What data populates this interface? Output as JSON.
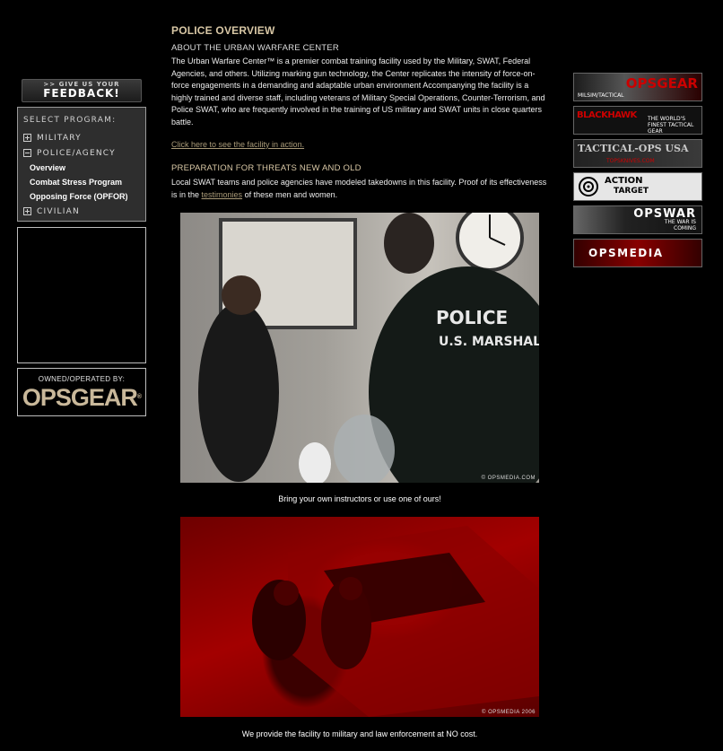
{
  "sidebar": {
    "feedback": {
      "top": ">> GIVE US YOUR",
      "main": "FEEDBACK!"
    },
    "program_header": "SELECT PROGRAM:",
    "programs": [
      {
        "label": "MILITARY",
        "toggle": "plus"
      },
      {
        "label": "POLICE/AGENCY",
        "toggle": "minus"
      }
    ],
    "police_sub": [
      "Overview",
      "Combat Stress Program",
      "Opposing Force (OPFOR)"
    ],
    "civilian": "CIVILIAN",
    "owned_label": "OWNED/OPERATED BY:",
    "owned_logo": "OPSGEAR",
    "owned_reg": "®"
  },
  "main": {
    "title": "POLICE OVERVIEW",
    "about_heading": "ABOUT THE URBAN WARFARE CENTER",
    "about_text": "The Urban Warfare Center™ is a premier combat training facility used by the Military, SWAT, Federal Agencies, and others. Utilizing marking gun technology, the Center replicates the intensity of force-on-force engagements in a demanding and adaptable urban environment Accompanying the facility is a highly trained and diverse staff, including veterans of Military Special Operations, Counter-Terrorism, and Police SWAT, who are frequently involved in the training of US military and SWAT units in close quarters battle.",
    "facility_link": "Click here to see the facility in action.",
    "prep_heading": "PREPARATION FOR THREATS NEW AND OLD",
    "prep_text_1": "Local SWAT teams and police agencies have modeled takedowns in this facility. Proof of its effectiveness is in the ",
    "prep_link": "testimonies",
    "prep_text_2": " of these men and women.",
    "photo1_watermark": "© OPSMEDIA.COM",
    "caption1": "Bring your own instructors or use one of ours!",
    "photo2_watermark": "© OPSMEDIA 2006",
    "caption2": "We provide the facility to military and law enforcement at NO cost."
  },
  "ads": [
    {
      "title": "OPSGEAR",
      "sub": "MILSIM/TACTICAL"
    },
    {
      "title": "BLACKHAWK",
      "sub": "THE WORLD'S FINEST TACTICAL GEAR"
    },
    {
      "title": "TACTICAL-OPS USA",
      "sub": "TOPSKNIVES.COM"
    },
    {
      "title": "ACTION",
      "sub": "TARGET"
    },
    {
      "title": "OPSWAR",
      "sub": "THE WAR IS COMING"
    },
    {
      "title": "OPSMEDIA",
      "sub": ""
    }
  ],
  "colors": {
    "accent": "#d8c7a5",
    "link": "#a99a78",
    "background": "#000000"
  }
}
